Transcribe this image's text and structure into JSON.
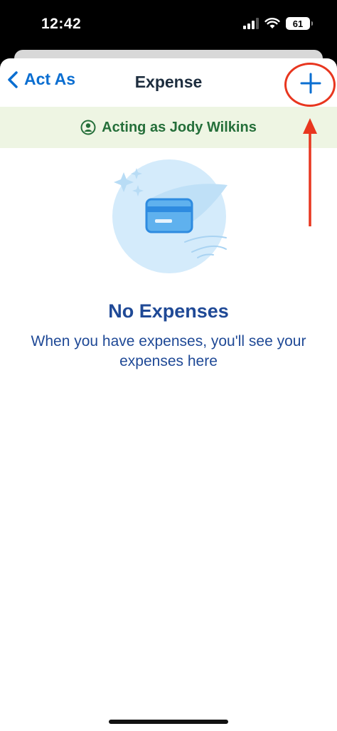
{
  "status_bar": {
    "time": "12:42",
    "battery": "61"
  },
  "nav": {
    "back_label": "Act As",
    "title": "Expense"
  },
  "banner": {
    "text": "Acting as Jody Wilkins"
  },
  "empty_state": {
    "title": "No Expenses",
    "message": "When you have expenses, you'll see your expenses here"
  },
  "colors": {
    "accent": "#0a6ed1",
    "banner_bg": "#eef5e3",
    "banner_text": "#256f3a",
    "empty_text": "#1f4996",
    "annotation": "#e8361f"
  }
}
